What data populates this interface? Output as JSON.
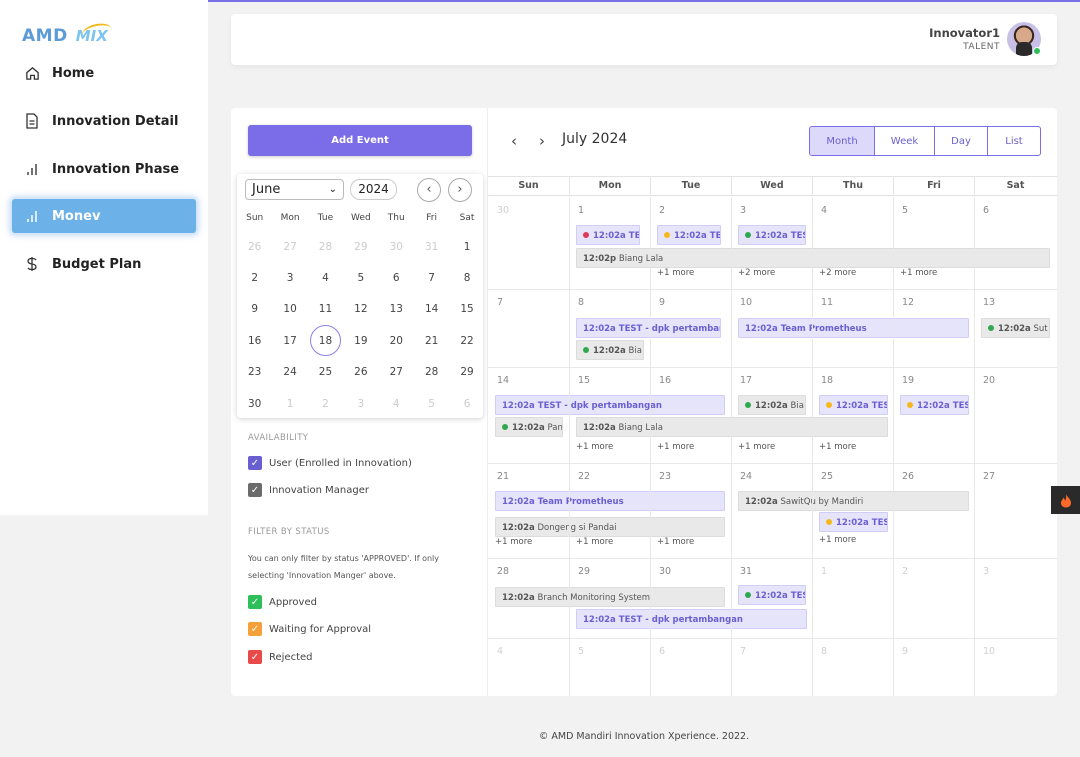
{
  "brand": {
    "amd": "AMD",
    "mix": "MIX"
  },
  "sidebar": {
    "items": [
      {
        "label": "Home",
        "icon": "home-icon"
      },
      {
        "label": "Innovation Detail",
        "icon": "document-icon"
      },
      {
        "label": "Innovation Phase",
        "icon": "bar-chart-icon"
      },
      {
        "label": "Monev",
        "icon": "bar-chart-icon",
        "active": true
      },
      {
        "label": "Budget Plan",
        "icon": "dollar-icon"
      }
    ]
  },
  "header": {
    "user_name": "Innovator1",
    "user_role": "TALENT"
  },
  "left": {
    "add_event": "Add Event",
    "mini_calendar": {
      "month": "June",
      "year": "2024",
      "dow": [
        "Sun",
        "Mon",
        "Tue",
        "Wed",
        "Thu",
        "Fri",
        "Sat"
      ],
      "days": [
        "26",
        "27",
        "28",
        "29",
        "30",
        "31",
        "1",
        "2",
        "3",
        "4",
        "5",
        "6",
        "7",
        "8",
        "9",
        "10",
        "11",
        "12",
        "13",
        "14",
        "15",
        "16",
        "17",
        "18",
        "19",
        "20",
        "21",
        "22",
        "23",
        "24",
        "25",
        "26",
        "27",
        "28",
        "29",
        "30",
        "1",
        "2",
        "3",
        "4",
        "5",
        "6"
      ],
      "selected": "18"
    },
    "availability_title": "AVAILABILITY",
    "availability": [
      {
        "label": "User (Enrolled in Innovation)",
        "color": "#6a5fd0"
      },
      {
        "label": "Innovation Manager",
        "color": "#6b6b6b"
      }
    ],
    "filter_title": "FILTER BY STATUS",
    "filter_note": "You can only filter by status 'APPROVED'. If only selecting 'Innovation Manger' above.",
    "statuses": [
      {
        "label": "Approved",
        "color": "#2fbf5a"
      },
      {
        "label": "Waiting for Approval",
        "color": "#f5a038"
      },
      {
        "label": "Rejected",
        "color": "#e84a4a"
      }
    ]
  },
  "calendar": {
    "title": "July 2024",
    "views": [
      "Month",
      "Week",
      "Day",
      "List"
    ],
    "active_view": "Month",
    "dow": [
      "Sun",
      "Mon",
      "Tue",
      "Wed",
      "Thu",
      "Fri",
      "Sat"
    ],
    "days": [
      "30",
      "1",
      "2",
      "3",
      "4",
      "5",
      "6",
      "7",
      "8",
      "9",
      "10",
      "11",
      "12",
      "13",
      "14",
      "15",
      "16",
      "17",
      "18",
      "19",
      "20",
      "21",
      "22",
      "23",
      "24",
      "25",
      "26",
      "27",
      "28",
      "29",
      "30",
      "31",
      "1",
      "2",
      "3",
      "4",
      "5",
      "6",
      "7",
      "8",
      "9",
      "10"
    ],
    "events": [
      {
        "time": "12:02a",
        "title": "TES",
        "dot": "#e03a5a"
      },
      {
        "time": "12:02a",
        "title": "TES",
        "dot": "#f5b81c"
      },
      {
        "time": "12:02a",
        "title": "TES",
        "dot": "#2fa84f"
      },
      {
        "time": "12:02p",
        "title": "Biang Lala"
      },
      {
        "time": "12:02a",
        "title": "TEST - dpk pertambangan"
      },
      {
        "time": "12:02a",
        "title": "Bia",
        "dot": "#2fa84f"
      },
      {
        "time": "12:02a",
        "title": "Team Prometheus"
      },
      {
        "time": "12:02a",
        "title": "Sut",
        "dot": "#2fa84f"
      },
      {
        "time": "12:02a",
        "title": "TEST - dpk pertambangan"
      },
      {
        "time": "12:02a",
        "title": "Pan",
        "dot": "#2fa84f"
      },
      {
        "time": "12:02a",
        "title": "Biang Lala"
      },
      {
        "time": "12:02a",
        "title": "Bia",
        "dot": "#2fa84f"
      },
      {
        "time": "12:02a",
        "title": "TES",
        "dot": "#f5b81c"
      },
      {
        "time": "12:02a",
        "title": "TES",
        "dot": "#f5b81c"
      },
      {
        "time": "12:02a",
        "title": "Team Prometheus"
      },
      {
        "time": "12:02a",
        "title": "SawitQu by Mandiri"
      },
      {
        "time": "12:02a",
        "title": "Dongeng si Pandai"
      },
      {
        "time": "12:02a",
        "title": "TES",
        "dot": "#f5b81c"
      },
      {
        "time": "12:02a",
        "title": "Branch Monitoring System"
      },
      {
        "time": "12:02a",
        "title": "TES",
        "dot": "#2fa84f"
      },
      {
        "time": "12:02a",
        "title": "TEST - dpk pertambangan"
      }
    ],
    "more": [
      "+1 more",
      "+2 more",
      "+2 more",
      "+1 more",
      "+1 more",
      "+1 more",
      "+1 more",
      "+1 more",
      "+1 more",
      "+1 more",
      "+1 more",
      "+1 more",
      "+1 more"
    ]
  },
  "footer": "© AMD Mandiri Innovation Xperience. 2022.",
  "colors": {
    "accent": "#7b6ce8",
    "active_nav": "#6cb1e8"
  }
}
